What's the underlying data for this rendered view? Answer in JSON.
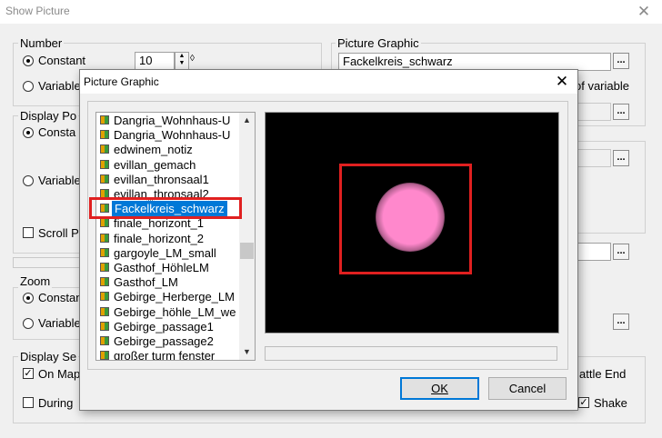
{
  "background_window": {
    "title": "Show Picture",
    "close_glyph": "✕",
    "number_group": {
      "label": "Number",
      "constant_label": "Constant",
      "variable_label": "Variable",
      "constant_value": "10",
      "selected": "constant"
    },
    "picture_graphic_group": {
      "label": "Picture Graphic",
      "value": "Fackelkreis_schwarz",
      "browse_glyph": "...",
      "suffix_text": "of variable"
    },
    "display_position_group": {
      "label": "Display Po",
      "constant_label": "Consta",
      "variable_label": "Variable",
      "scroll_label": "Scroll P"
    },
    "zoom_group": {
      "label": "Zoom",
      "constant_label": "Constant",
      "variable_label": "Variable"
    },
    "display_settings_group": {
      "label": "Display Se",
      "on_map_label": "On Map",
      "on_map_checked": true,
      "during_label": "During",
      "battle_end_label": "attle End",
      "shake_label": "Shake",
      "shake_checked": true
    }
  },
  "dialog": {
    "title": "Picture Graphic",
    "close_glyph": "✕",
    "items": [
      "Dangria_Wohnhaus-U",
      "Dangria_Wohnhaus-U",
      "edwinem_notiz",
      "evillan_gemach",
      "evillan_thronsaal1",
      "evillan_thronsaal2",
      "Fackelkreis_schwarz",
      "finale_horizont_1",
      "finale_horizont_2",
      "gargoyle_LM_small",
      "Gasthof_HöhleLM",
      "Gasthof_LM",
      "Gebirge_Herberge_LM",
      "Gebirge_höhle_LM_we",
      "Gebirge_passage1",
      "Gebirge_passage2",
      "großer turm fenster"
    ],
    "selected_item": "Fackelkreis_schwarz",
    "ok_label": "OK",
    "cancel_label": "Cancel",
    "highlight_color": "#e02020",
    "selection_color": "#0078d7",
    "preview_glow_color": "#ff88cc"
  }
}
